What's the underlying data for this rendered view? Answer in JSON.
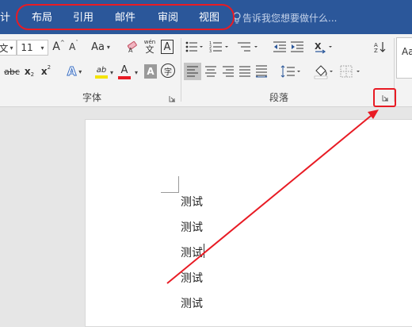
{
  "title_tabs": {
    "partial_design": "计",
    "layout": "布局",
    "references": "引用",
    "mailings": "邮件",
    "review": "审阅",
    "view": "视图"
  },
  "tell_me": {
    "placeholder": "告诉我您想要做什么..."
  },
  "font_group": {
    "font_name_partial": "文",
    "font_size": "11",
    "grow": "A",
    "shrink": "A",
    "change_case": "Aa",
    "phonetic_top": "wén",
    "phonetic_bottom": "文",
    "char_border": "A",
    "strike": "abc",
    "subscript": "x",
    "subscript_mark": "2",
    "superscript": "x",
    "superscript_mark": "2",
    "text_effects": "A",
    "highlight": "ab",
    "font_color": "A",
    "char_shading": "A",
    "enclose": "字",
    "label": "字体"
  },
  "paragraph_group": {
    "label": "段落"
  },
  "styles_group": {
    "preview": "Aa"
  },
  "document": {
    "lines": [
      "测试",
      "测试",
      "测试",
      "测试",
      "测试"
    ]
  },
  "colors": {
    "title_bar": "#2b579a",
    "annotation": "#e81b24",
    "highlight_yellow": "#f4e400",
    "font_red": "#e81b24",
    "text_effects_blue": "#3a6fc4"
  }
}
